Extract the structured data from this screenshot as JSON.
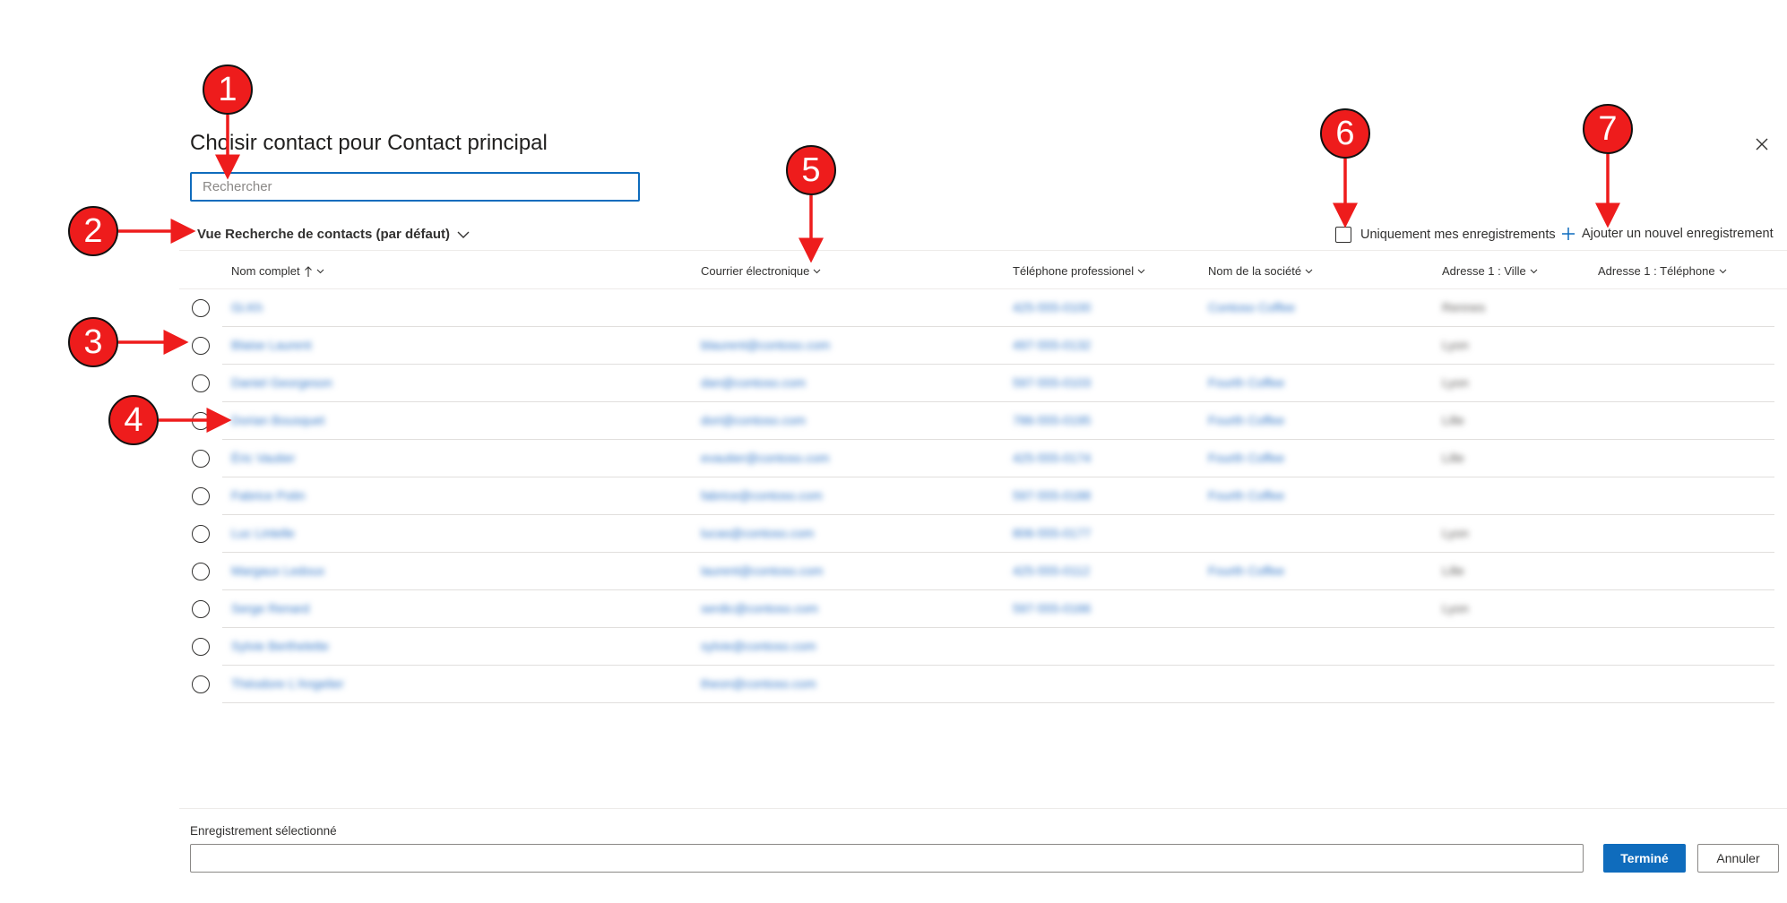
{
  "dialog": {
    "title": "Choisir contact pour Contact principal",
    "search_placeholder": "Rechercher",
    "view_label": "Vue Recherche de contacts (par défaut)",
    "only_mine_label": "Uniquement mes enregistrements",
    "add_new_label": "Ajouter un nouvel enregistrement"
  },
  "columns": [
    {
      "label": "Nom complet",
      "sorted": "ascending"
    },
    {
      "label": "Courrier électronique"
    },
    {
      "label": "Téléphone professionel"
    },
    {
      "label": "Nom de la société"
    },
    {
      "label": "Adresse 1 : Ville"
    },
    {
      "label": "Adresse 1 : Téléphone"
    }
  ],
  "rows": [
    {
      "name": "Gi.Kh",
      "email": "",
      "phone": "425-555-0100",
      "company": "Contoso Coffee",
      "city": "Rennes",
      "tel": ""
    },
    {
      "name": "Blaise Laurent",
      "email": "blaurent@contoso.com",
      "phone": "497-555-0132",
      "company": "",
      "city": "Lyon",
      "tel": ""
    },
    {
      "name": "Daniel Georgeson",
      "email": "dan@contoso.com",
      "phone": "597-555-0103",
      "company": "Fourth Coffee",
      "city": "Lyon",
      "tel": ""
    },
    {
      "name": "Dorian Bousquet",
      "email": "dori@contoso.com",
      "phone": "786-555-0195",
      "company": "Fourth Coffee",
      "city": "Lille",
      "tel": ""
    },
    {
      "name": "Éric Vautier",
      "email": "evautier@contoso.com",
      "phone": "425-555-0174",
      "company": "Fourth Coffee",
      "city": "Lille",
      "tel": ""
    },
    {
      "name": "Fabrice Potin",
      "email": "fabrice@contoso.com",
      "phone": "597-555-0188",
      "company": "Fourth Coffee",
      "city": "",
      "tel": ""
    },
    {
      "name": "Luc Lintelle",
      "email": "lucas@contoso.com",
      "phone": "806-555-0177",
      "company": "",
      "city": "Lyon",
      "tel": ""
    },
    {
      "name": "Margaux Ledoux",
      "email": "laurent@contoso.com",
      "phone": "425-555-0112",
      "company": "Fourth Coffee",
      "city": "Lille",
      "tel": ""
    },
    {
      "name": "Serge Renard",
      "email": "serdic@contoso.com",
      "phone": "597-555-0166",
      "company": "",
      "city": "Lyon",
      "tel": ""
    },
    {
      "name": "Sylvie Berthelette",
      "email": "sylvie@contoso.com",
      "phone": "",
      "company": "",
      "city": "",
      "tel": ""
    },
    {
      "name": "Théodore L'Angelier",
      "email": "theon@contoso.com",
      "phone": "",
      "company": "",
      "city": "",
      "tel": ""
    }
  ],
  "footer": {
    "selected_label": "Enregistrement sélectionné",
    "done_label": "Terminé",
    "cancel_label": "Annuler"
  },
  "callouts": [
    "1",
    "2",
    "3",
    "4",
    "5",
    "6",
    "7"
  ],
  "colors": {
    "accent": "#0f6cbd",
    "link": "#2f75c7",
    "callout": "#ee1c1c"
  },
  "icons": [
    "close-icon",
    "chevron-down-icon",
    "sort-up-arrow-icon",
    "plus-icon"
  ]
}
